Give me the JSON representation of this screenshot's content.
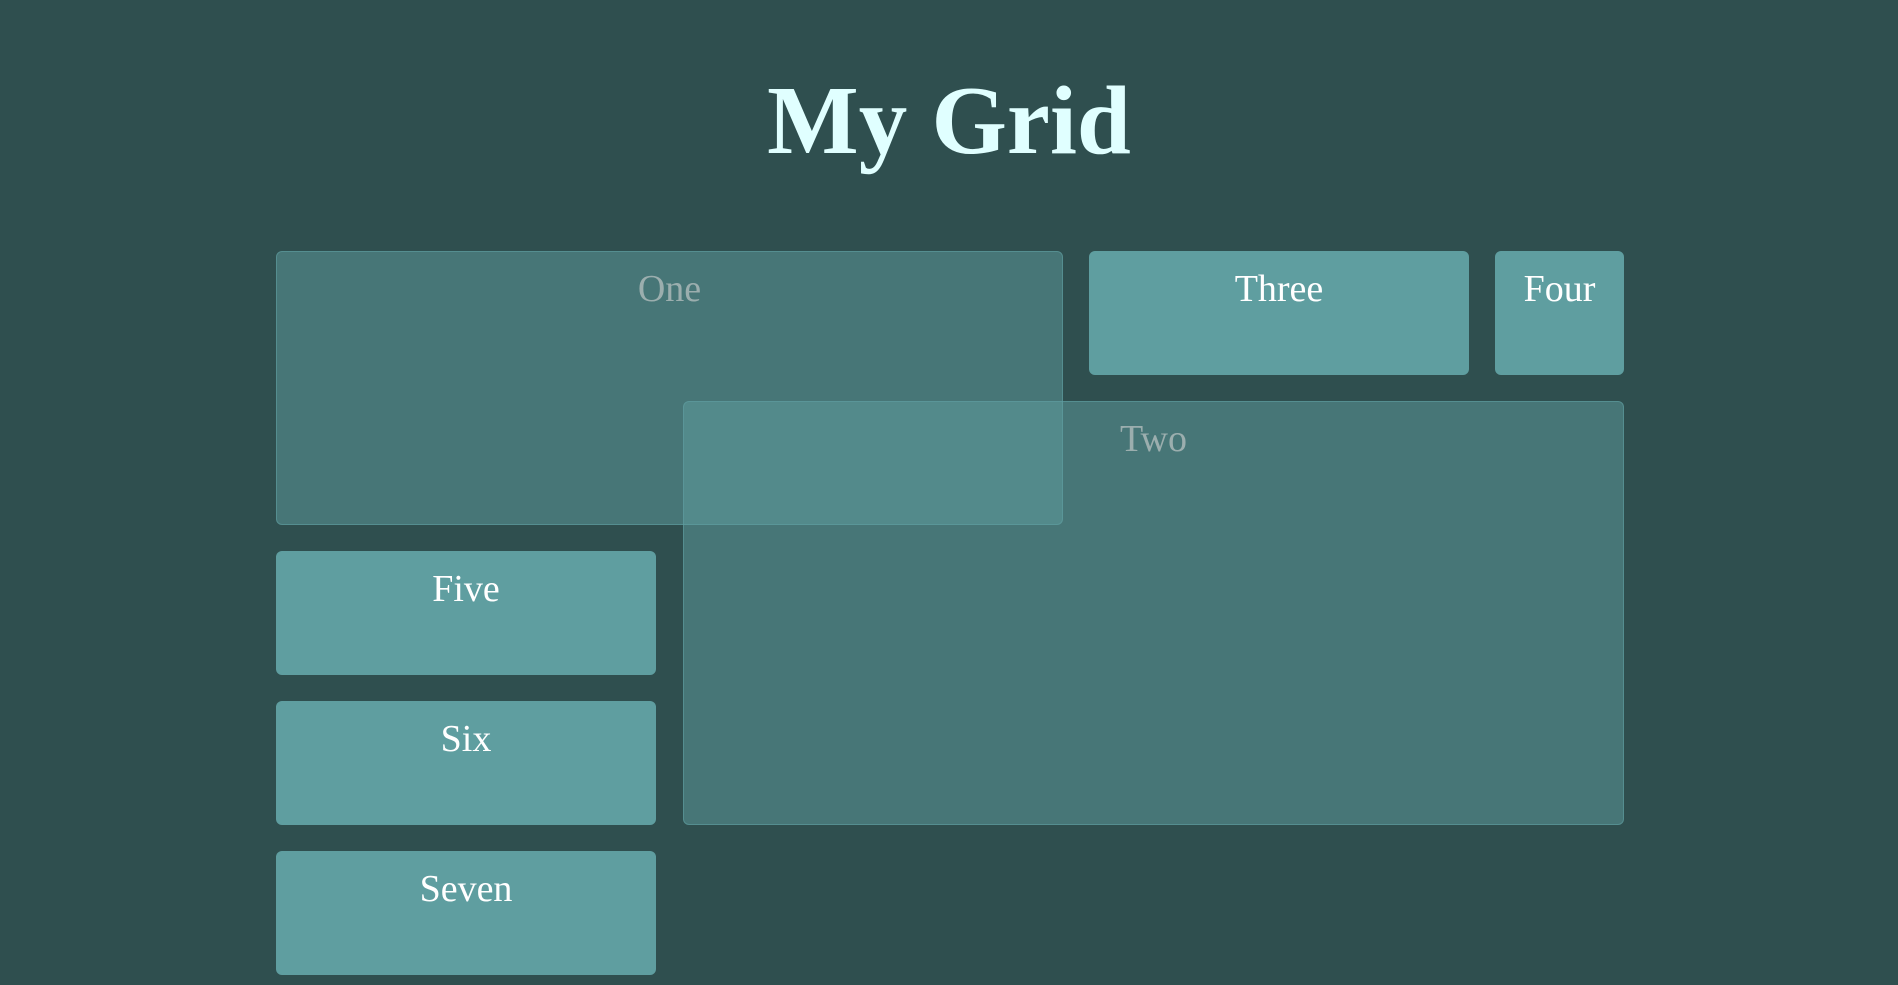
{
  "page": {
    "title": "My Grid"
  },
  "grid": {
    "cells": {
      "one": "One",
      "two": "Two",
      "three": "Three",
      "four": "Four",
      "five": "Five",
      "six": "Six",
      "seven": "Seven"
    }
  },
  "colors": {
    "background": "#2f4f4f",
    "title": "#e0ffff",
    "cell": "#5f9ea0",
    "cell_text": "#ffffff",
    "faded_cell_text": "#a9a9a9"
  }
}
